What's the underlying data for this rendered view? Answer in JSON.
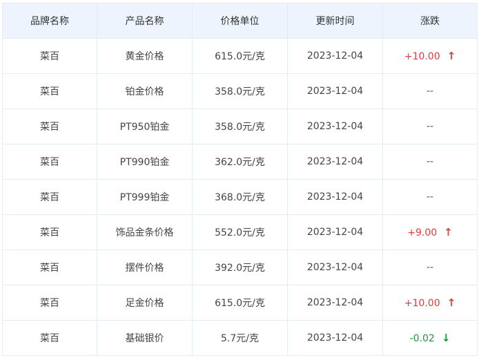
{
  "colors": {
    "header_bg": "#eef4fd",
    "border": "#e4ebf3",
    "up": "#e8383d",
    "down": "#1a9a35"
  },
  "table": {
    "headers": [
      "品牌名称",
      "产品名称",
      "价格单位",
      "更新时间",
      "涨跌"
    ],
    "rows": [
      {
        "brand": "菜百",
        "product": "黄金价格",
        "price": "615.0元/克",
        "date": "2023-12-04",
        "change": "+10.00",
        "trend": "up",
        "trend_icon": "arrow-up-icon"
      },
      {
        "brand": "菜百",
        "product": "铂金价格",
        "price": "358.0元/克",
        "date": "2023-12-04",
        "change": "--",
        "trend": "none",
        "trend_icon": ""
      },
      {
        "brand": "菜百",
        "product": "PT950铂金",
        "price": "358.0元/克",
        "date": "2023-12-04",
        "change": "--",
        "trend": "none",
        "trend_icon": ""
      },
      {
        "brand": "菜百",
        "product": "PT990铂金",
        "price": "362.0元/克",
        "date": "2023-12-04",
        "change": "--",
        "trend": "none",
        "trend_icon": ""
      },
      {
        "brand": "菜百",
        "product": "PT999铂金",
        "price": "368.0元/克",
        "date": "2023-12-04",
        "change": "--",
        "trend": "none",
        "trend_icon": ""
      },
      {
        "brand": "菜百",
        "product": "饰品金条价格",
        "price": "552.0元/克",
        "date": "2023-12-04",
        "change": "+9.00",
        "trend": "up",
        "trend_icon": "arrow-up-icon"
      },
      {
        "brand": "菜百",
        "product": "摆件价格",
        "price": "392.0元/克",
        "date": "2023-12-04",
        "change": "--",
        "trend": "none",
        "trend_icon": ""
      },
      {
        "brand": "菜百",
        "product": "足金价格",
        "price": "615.0元/克",
        "date": "2023-12-04",
        "change": "+10.00",
        "trend": "up",
        "trend_icon": "arrow-up-icon"
      },
      {
        "brand": "菜百",
        "product": "基础银价",
        "price": "5.7元/克",
        "date": "2023-12-04",
        "change": "-0.02",
        "trend": "down",
        "trend_icon": "arrow-down-icon"
      }
    ]
  }
}
